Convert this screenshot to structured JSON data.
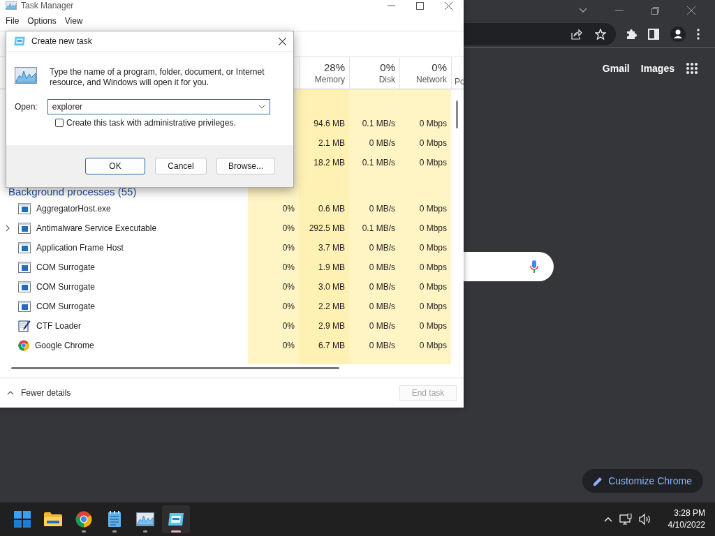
{
  "task_manager": {
    "title": "Task Manager",
    "menu": [
      "File",
      "Options",
      "View"
    ],
    "columns": [
      {
        "percent": "28%",
        "label": "Memory"
      },
      {
        "percent": "0%",
        "label": "Disk"
      },
      {
        "percent": "0%",
        "label": "Network"
      },
      {
        "label": "Po"
      }
    ],
    "app_rows": [
      {
        "memory": "94.6 MB",
        "disk": "0.1 MB/s",
        "network": "0 Mbps"
      },
      {
        "memory": "2.1 MB",
        "disk": "0 MB/s",
        "network": "0 Mbps"
      },
      {
        "memory": "18.2 MB",
        "disk": "0.1 MB/s",
        "network": "0 Mbps"
      }
    ],
    "group_title": "Background processes (55)",
    "rows": [
      {
        "kind": "service",
        "name": "AggregatorHost.exe",
        "expandable": false,
        "cpu": "0%",
        "memory": "0.6 MB",
        "disk": "0 MB/s",
        "network": "0 Mbps"
      },
      {
        "kind": "service",
        "name": "Antimalware Service Executable",
        "expandable": true,
        "cpu": "0%",
        "memory": "292.5 MB",
        "disk": "0.1 MB/s",
        "network": "0 Mbps"
      },
      {
        "kind": "service",
        "name": "Application Frame Host",
        "expandable": false,
        "cpu": "0%",
        "memory": "3.7 MB",
        "disk": "0 MB/s",
        "network": "0 Mbps"
      },
      {
        "kind": "service",
        "name": "COM Surrogate",
        "expandable": false,
        "cpu": "0%",
        "memory": "1.9 MB",
        "disk": "0 MB/s",
        "network": "0 Mbps"
      },
      {
        "kind": "service",
        "name": "COM Surrogate",
        "expandable": false,
        "cpu": "0%",
        "memory": "3.0 MB",
        "disk": "0 MB/s",
        "network": "0 Mbps"
      },
      {
        "kind": "service",
        "name": "COM Surrogate",
        "expandable": false,
        "cpu": "0%",
        "memory": "2.2 MB",
        "disk": "0 MB/s",
        "network": "0 Mbps"
      },
      {
        "kind": "ctf",
        "name": "CTF Loader",
        "expandable": false,
        "cpu": "0%",
        "memory": "2.9 MB",
        "disk": "0 MB/s",
        "network": "0 Mbps"
      },
      {
        "kind": "chrome",
        "name": "Google Chrome",
        "expandable": false,
        "cpu": "0%",
        "memory": "6.7 MB",
        "disk": "0 MB/s",
        "network": "0 Mbps"
      }
    ],
    "fewer_details": "Fewer details",
    "end_task": {
      "label": "End task",
      "disabled": true
    }
  },
  "dialog": {
    "title": "Create new task",
    "message": "Type the name of a program, folder, document, or Internet resource, and Windows will open it for you.",
    "open_label": "Open:",
    "value": "explorer",
    "admin_checkbox": {
      "label": "Create this task with administrative privileges.",
      "checked": false
    },
    "buttons": [
      {
        "label": "OK",
        "default": true
      },
      {
        "label": "Cancel",
        "default": false
      },
      {
        "label": "Browse...",
        "default": false
      }
    ]
  },
  "chrome": {
    "links": [
      "Gmail",
      "Images"
    ],
    "customize": "Customize Chrome"
  },
  "taskbar": {
    "apps": [
      {
        "kind": "start",
        "running": false,
        "selected": false
      },
      {
        "kind": "folder",
        "running": false,
        "selected": false
      },
      {
        "kind": "chrome",
        "running": true,
        "selected": false
      },
      {
        "kind": "notepad",
        "running": true,
        "selected": false
      },
      {
        "kind": "taskmgr",
        "running": true,
        "selected": false
      },
      {
        "kind": "run",
        "running": true,
        "selected": true
      }
    ],
    "time": "3:28 PM",
    "date": "4/10/2022"
  }
}
